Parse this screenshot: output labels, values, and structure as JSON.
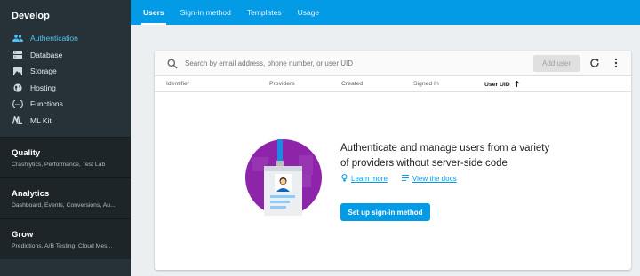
{
  "sidebar": {
    "develop": {
      "title": "Develop",
      "items": [
        {
          "label": "Authentication",
          "icon": "people-icon"
        },
        {
          "label": "Database",
          "icon": "database-icon"
        },
        {
          "label": "Storage",
          "icon": "image-icon"
        },
        {
          "label": "Hosting",
          "icon": "globe-icon"
        },
        {
          "label": "Functions",
          "icon": "functions-icon"
        },
        {
          "label": "ML Kit",
          "icon": "ml-kit-icon"
        }
      ]
    },
    "groups": [
      {
        "title": "Quality",
        "subtitle": "Crashlytics, Performance, Test Lab"
      },
      {
        "title": "Analytics",
        "subtitle": "Dashboard, Events, Conversions, Au..."
      },
      {
        "title": "Grow",
        "subtitle": "Predictions, A/B Testing, Cloud Mes..."
      }
    ]
  },
  "tabs": [
    "Users",
    "Sign-in method",
    "Templates",
    "Usage"
  ],
  "search": {
    "placeholder": "Search by email address, phone number, or user UID"
  },
  "toolbar": {
    "add_user": "Add user"
  },
  "columns": [
    "Identifier",
    "Providers",
    "Created",
    "Signed In",
    "User UID"
  ],
  "empty_state": {
    "title": "Authenticate and manage users from a variety of providers without server-side code",
    "learn_more": "Learn more",
    "view_docs": "View the docs",
    "setup_button": "Set up sign-in method"
  },
  "colors": {
    "accent": "#039be5",
    "sidebar": "#263238",
    "active_item": "#4fc3f7"
  }
}
